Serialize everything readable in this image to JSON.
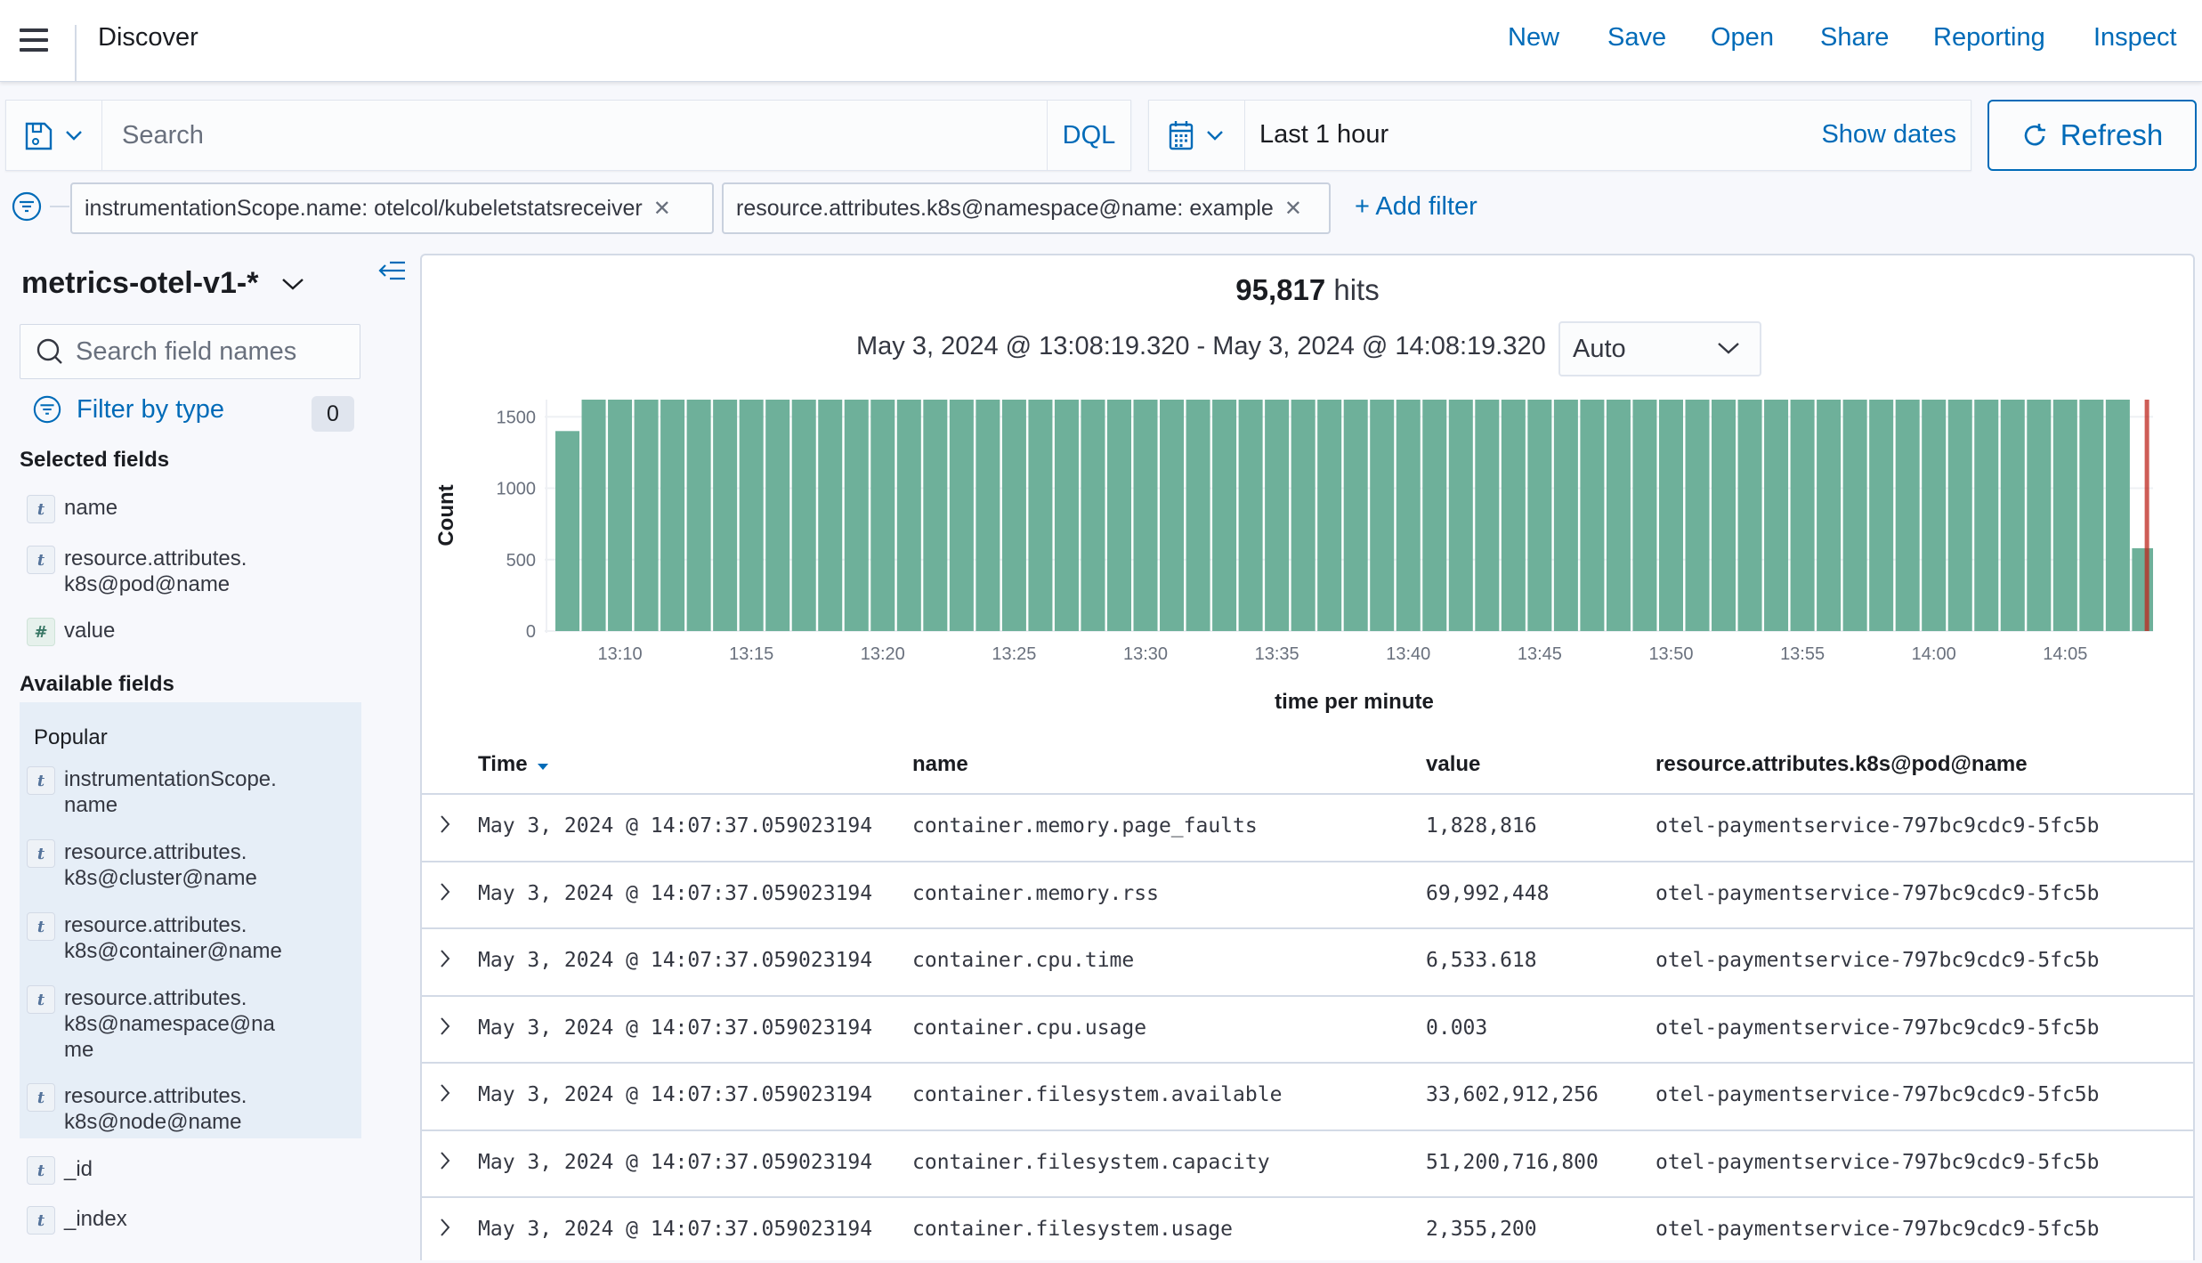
{
  "header": {
    "title": "Discover",
    "nav": [
      "New",
      "Save",
      "Open",
      "Share",
      "Reporting",
      "Inspect"
    ]
  },
  "query_bar": {
    "search_placeholder": "Search",
    "search_value": "",
    "language": "DQL"
  },
  "date_picker": {
    "range": "Last 1 hour",
    "show_dates": "Show dates",
    "refresh": "Refresh"
  },
  "filters": {
    "pills": [
      "instrumentationScope.name: otelcol/kubeletstatsreceiver",
      "resource.attributes.k8s@namespace@name: example"
    ],
    "add_filter": "+ Add filter"
  },
  "sidebar": {
    "index_pattern": "metrics-otel-v1-*",
    "search_placeholder": "Search field names",
    "filter_by_type": "Filter by type",
    "filter_count": "0",
    "selected_title": "Selected fields",
    "selected_fields": [
      {
        "type": "t",
        "name": "name"
      },
      {
        "type": "t",
        "name": "resource.attributes.\nk8s@pod@name"
      },
      {
        "type": "#",
        "name": "value"
      }
    ],
    "available_title": "Available fields",
    "popular_label": "Popular",
    "popular_fields": [
      {
        "type": "t",
        "name": "instrumentationScope.\nname"
      },
      {
        "type": "t",
        "name": "resource.attributes.\nk8s@cluster@name"
      },
      {
        "type": "t",
        "name": "resource.attributes.\nk8s@container@name"
      },
      {
        "type": "t",
        "name": "resource.attributes.\nk8s@namespace@na\nme"
      },
      {
        "type": "t",
        "name": "resource.attributes.\nk8s@node@name"
      }
    ],
    "other_fields": [
      {
        "type": "t",
        "name": "_id"
      },
      {
        "type": "t",
        "name": "_index"
      }
    ]
  },
  "summary": {
    "hits_count": "95,817",
    "hits_label": "hits",
    "time_range": "May 3, 2024 @ 13:08:19.320 - May 3, 2024 @ 14:08:19.320",
    "interval": "Auto"
  },
  "chart_data": {
    "type": "bar",
    "title": "",
    "xlabel": "time per minute",
    "ylabel": "Count",
    "ylim": [
      0,
      1620
    ],
    "yticks": [
      0,
      500,
      1000,
      1500
    ],
    "xticks": [
      "13:10",
      "13:15",
      "13:20",
      "13:25",
      "13:30",
      "13:35",
      "13:40",
      "13:45",
      "13:50",
      "13:55",
      "14:00",
      "14:05"
    ],
    "x_start": "13:08",
    "x_interval_minutes": 1,
    "grid": true,
    "bar_color": "#6eb09a",
    "now_marker_color": "#bd271e",
    "values": [
      1400,
      1620,
      1620,
      1620,
      1620,
      1620,
      1620,
      1620,
      1620,
      1620,
      1620,
      1620,
      1620,
      1620,
      1620,
      1620,
      1620,
      1620,
      1620,
      1620,
      1620,
      1620,
      1620,
      1620,
      1620,
      1620,
      1620,
      1620,
      1620,
      1620,
      1620,
      1620,
      1620,
      1620,
      1620,
      1620,
      1620,
      1620,
      1620,
      1620,
      1620,
      1620,
      1620,
      1620,
      1620,
      1620,
      1620,
      1620,
      1620,
      1620,
      1620,
      1620,
      1620,
      1620,
      1620,
      1620,
      1620,
      1620,
      1620,
      1620,
      580
    ]
  },
  "table": {
    "columns": [
      "Time",
      "name",
      "value",
      "resource.attributes.k8s@pod@name"
    ],
    "sort_column": "Time",
    "rows": [
      [
        "May 3, 2024 @ 14:07:37.059023194",
        "container.memory.page_faults",
        "1,828,816",
        "otel-paymentservice-797bc9cdc9-5fc5b"
      ],
      [
        "May 3, 2024 @ 14:07:37.059023194",
        "container.memory.rss",
        "69,992,448",
        "otel-paymentservice-797bc9cdc9-5fc5b"
      ],
      [
        "May 3, 2024 @ 14:07:37.059023194",
        "container.cpu.time",
        "6,533.618",
        "otel-paymentservice-797bc9cdc9-5fc5b"
      ],
      [
        "May 3, 2024 @ 14:07:37.059023194",
        "container.cpu.usage",
        "0.003",
        "otel-paymentservice-797bc9cdc9-5fc5b"
      ],
      [
        "May 3, 2024 @ 14:07:37.059023194",
        "container.filesystem.available",
        "33,602,912,256",
        "otel-paymentservice-797bc9cdc9-5fc5b"
      ],
      [
        "May 3, 2024 @ 14:07:37.059023194",
        "container.filesystem.capacity",
        "51,200,716,800",
        "otel-paymentservice-797bc9cdc9-5fc5b"
      ],
      [
        "May 3, 2024 @ 14:07:37.059023194",
        "container.filesystem.usage",
        "2,355,200",
        "otel-paymentservice-797bc9cdc9-5fc5b"
      ]
    ]
  },
  "colors": {
    "accent": "#006bb8",
    "text": "#343741",
    "border": "#d3dae6"
  }
}
